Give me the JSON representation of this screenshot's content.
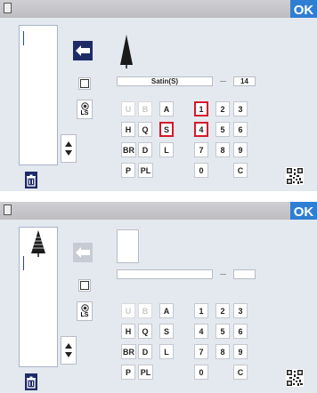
{
  "screens": [
    {
      "ok_label": "OK",
      "stitch_name": "Satin(S)",
      "stitch_number": "14",
      "letters": [
        {
          "label": "U",
          "enabled": false,
          "highlight": false
        },
        {
          "label": "B",
          "enabled": false,
          "highlight": false
        },
        {
          "label": "A",
          "enabled": true,
          "highlight": false
        },
        {
          "label": "H",
          "enabled": true,
          "highlight": false
        },
        {
          "label": "Q",
          "enabled": true,
          "highlight": false
        },
        {
          "label": "S",
          "enabled": true,
          "highlight": true
        },
        {
          "label": "BR",
          "enabled": true,
          "highlight": false
        },
        {
          "label": "D",
          "enabled": true,
          "highlight": false
        },
        {
          "label": "L",
          "enabled": true,
          "highlight": false
        },
        {
          "label": "P",
          "enabled": true,
          "highlight": false
        },
        {
          "label": "PL",
          "enabled": true,
          "highlight": false
        }
      ],
      "numbers": [
        {
          "label": "1",
          "highlight": true
        },
        {
          "label": "2",
          "highlight": false
        },
        {
          "label": "3",
          "highlight": false
        },
        {
          "label": "4",
          "highlight": true
        },
        {
          "label": "5",
          "highlight": false
        },
        {
          "label": "6",
          "highlight": false
        },
        {
          "label": "7",
          "highlight": false
        },
        {
          "label": "8",
          "highlight": false
        },
        {
          "label": "9",
          "highlight": false
        },
        {
          "label": "0",
          "highlight": false
        },
        {
          "label": "C",
          "highlight": false
        }
      ],
      "ls_label": "LS"
    },
    {
      "ok_label": "OK",
      "stitch_name": "",
      "stitch_number": "",
      "letters": [
        {
          "label": "U",
          "enabled": false,
          "highlight": false
        },
        {
          "label": "B",
          "enabled": false,
          "highlight": false
        },
        {
          "label": "A",
          "enabled": true,
          "highlight": false
        },
        {
          "label": "H",
          "enabled": true,
          "highlight": false
        },
        {
          "label": "Q",
          "enabled": true,
          "highlight": false
        },
        {
          "label": "S",
          "enabled": true,
          "highlight": false
        },
        {
          "label": "BR",
          "enabled": true,
          "highlight": false
        },
        {
          "label": "D",
          "enabled": true,
          "highlight": false
        },
        {
          "label": "L",
          "enabled": true,
          "highlight": false
        },
        {
          "label": "P",
          "enabled": true,
          "highlight": false
        },
        {
          "label": "PL",
          "enabled": true,
          "highlight": false
        }
      ],
      "numbers": [
        {
          "label": "1",
          "highlight": false
        },
        {
          "label": "2",
          "highlight": false
        },
        {
          "label": "3",
          "highlight": false
        },
        {
          "label": "4",
          "highlight": false
        },
        {
          "label": "5",
          "highlight": false
        },
        {
          "label": "6",
          "highlight": false
        },
        {
          "label": "7",
          "highlight": false
        },
        {
          "label": "8",
          "highlight": false
        },
        {
          "label": "9",
          "highlight": false
        },
        {
          "label": "0",
          "highlight": false
        },
        {
          "label": "C",
          "highlight": false
        }
      ],
      "ls_label": "LS"
    }
  ],
  "colors": {
    "accent": "#2e7fd3",
    "dark_button": "#1f2b67",
    "highlight": "#d7182a",
    "background": "#e4e8ef"
  },
  "icons": [
    "menu-icon",
    "back-arrow-icon",
    "stitch-preview-icon",
    "checkbox-icon",
    "ls-radio-icon",
    "scroll-up-icon",
    "scroll-down-icon",
    "trash-icon",
    "qr-code-icon",
    "tree-stitch-icon"
  ]
}
